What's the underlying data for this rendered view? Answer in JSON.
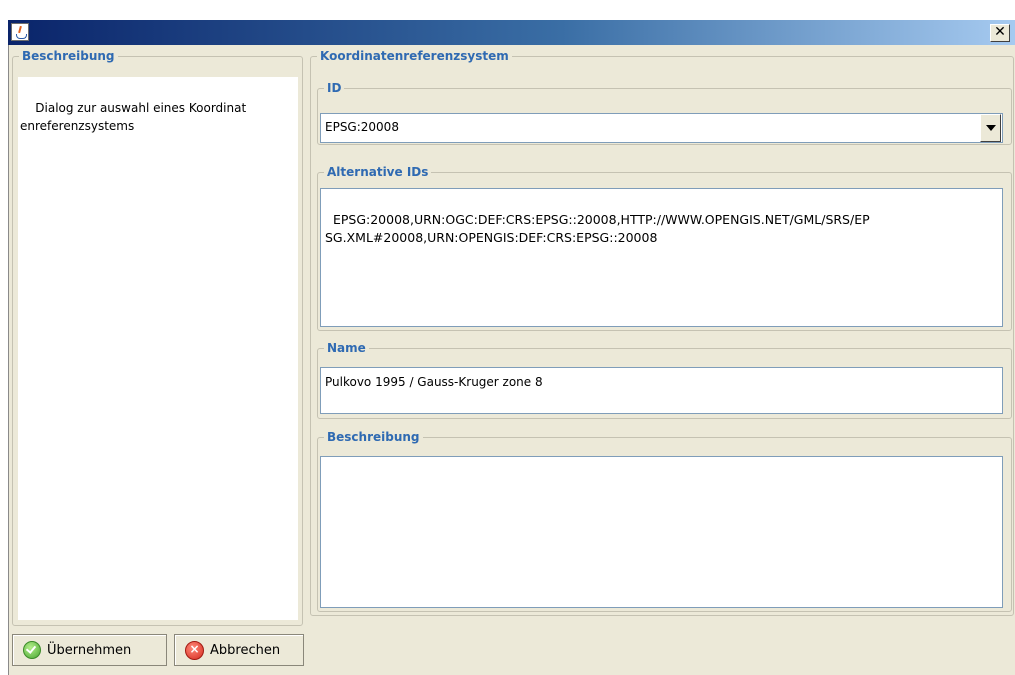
{
  "window": {
    "close_glyph": "✕",
    "icon": "java-coffee-icon"
  },
  "left_panel": {
    "title": "Beschreibung",
    "description": "Dialog zur auswahl eines Koordinat\nenreferenzsystems"
  },
  "crs_group": {
    "title": "Koordinatenreferenzsystem",
    "id_section": {
      "title": "ID",
      "selected_value": "EPSG:20008",
      "arrow_icon": "chevron-down-icon"
    },
    "alternative_ids": {
      "title": "Alternative IDs",
      "value": "EPSG:20008,URN:OGC:DEF:CRS:EPSG::20008,HTTP://WWW.OPENGIS.NET/GML/SRS/EP\nSG.XML#20008,URN:OPENGIS:DEF:CRS:EPSG::20008"
    },
    "name": {
      "title": "Name",
      "value": "Pulkovo 1995 / Gauss-Kruger zone 8"
    },
    "description": {
      "title": "Beschreibung",
      "value": ""
    }
  },
  "buttons": {
    "apply_label": "Übernehmen",
    "apply_icon": "check-circle-icon",
    "cancel_label": "Abbrechen",
    "cancel_icon": "cancel-circle-icon",
    "cancel_glyph": "×"
  },
  "colors": {
    "title_gradient_start": "#0a246a",
    "title_gradient_end": "#a6caf0",
    "section_title": "#2f6ab2",
    "dialog_background": "#ece9d8"
  }
}
